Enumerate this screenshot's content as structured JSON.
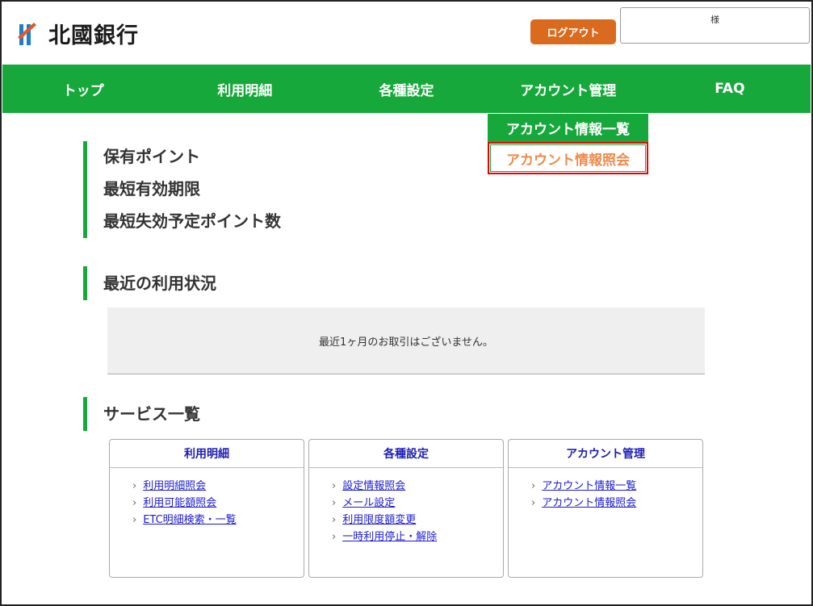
{
  "header": {
    "logo_text": "北國銀行",
    "logout_label": "ログアウト",
    "user_suffix": "様"
  },
  "nav": {
    "items": [
      "トップ",
      "利用明細",
      "各種設定",
      "アカウント管理",
      "FAQ"
    ]
  },
  "dropdown": {
    "items": [
      "アカウント情報一覧",
      "アカウント情報照会"
    ]
  },
  "points": {
    "labels": [
      "保有ポイント",
      "最短有効期限",
      "最短失効予定ポイント数"
    ]
  },
  "recent": {
    "title": "最近の利用状況",
    "empty_message": "最近1ヶ月のお取引はございません。"
  },
  "services": {
    "title": "サービス一覧",
    "cards": [
      {
        "title": "利用明細",
        "links": [
          "利用明細照会",
          "利用可能額照会",
          "ETC明細検索・一覧"
        ]
      },
      {
        "title": "各種設定",
        "links": [
          "設定情報照会",
          "メール設定",
          "利用限度額変更",
          "一時利用停止・解除"
        ]
      },
      {
        "title": "アカウント管理",
        "links": [
          "アカウント情報一覧",
          "アカウント情報照会"
        ]
      }
    ]
  },
  "colors": {
    "brand_green": "#17a83c",
    "logout_orange": "#d96a1e",
    "highlight_red": "#ee0000",
    "link_blue": "#1a1ad6"
  }
}
